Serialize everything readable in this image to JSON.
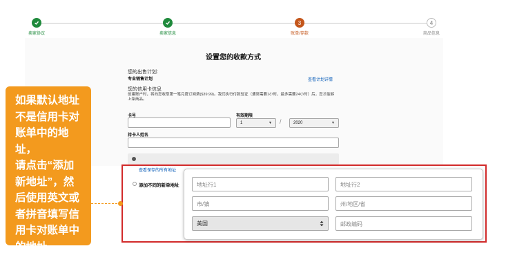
{
  "stepper": {
    "steps": [
      {
        "label": "卖家协议",
        "state": "done",
        "number": ""
      },
      {
        "label": "卖家信息",
        "state": "done",
        "number": ""
      },
      {
        "label": "账单/存款",
        "state": "current",
        "number": "3"
      },
      {
        "label": "商品信息",
        "state": "future",
        "number": "4"
      }
    ]
  },
  "page_title": "设置您的收款方式",
  "sales_plan": {
    "heading": "您的出售计划:",
    "value": "专业销售计划",
    "link": "查看计划详情"
  },
  "credit_card": {
    "heading": "您的信用卡信息",
    "note": "创建账户时，将向您收取第一笔月度订阅费($39.99)。我们执行付款验证（通常需要1小时，最多需要24小时）后，您才能够上架商品。",
    "card_number_label": "卡号",
    "card_number_value": "",
    "expiry_label": "有效期限",
    "expiry_month": "1",
    "expiry_year": "2020",
    "expiry_separator": "/",
    "holder_label": "持卡人姓名",
    "holder_value": ""
  },
  "address": {
    "saved_link": "查看保存的所有地址",
    "add_new_label": "添加不同的新单地址",
    "line1_placeholder": "地址行1",
    "line2_placeholder": "地址行2",
    "city_placeholder": "市/镇",
    "state_placeholder": "州/地区/省",
    "country_value": "美国",
    "zip_placeholder": "邮政编码"
  },
  "callout": {
    "lines": [
      "如果默认地址",
      "不是信用卡对",
      "账单中的地址，",
      "请点击“添加",
      "新地址”，然",
      "后使用英文或",
      "者拼音填写信",
      "用卡对账单中",
      "的地址"
    ]
  },
  "colors": {
    "done_green": "#1f8a3c",
    "current_orange": "#c4561b",
    "callout_orange": "#f39a1e",
    "highlight_red": "#d22a2a",
    "link_blue": "#0a5db8"
  },
  "icons": {
    "done_step": "check-icon",
    "select_arrow": "up-down-caret-icon"
  }
}
